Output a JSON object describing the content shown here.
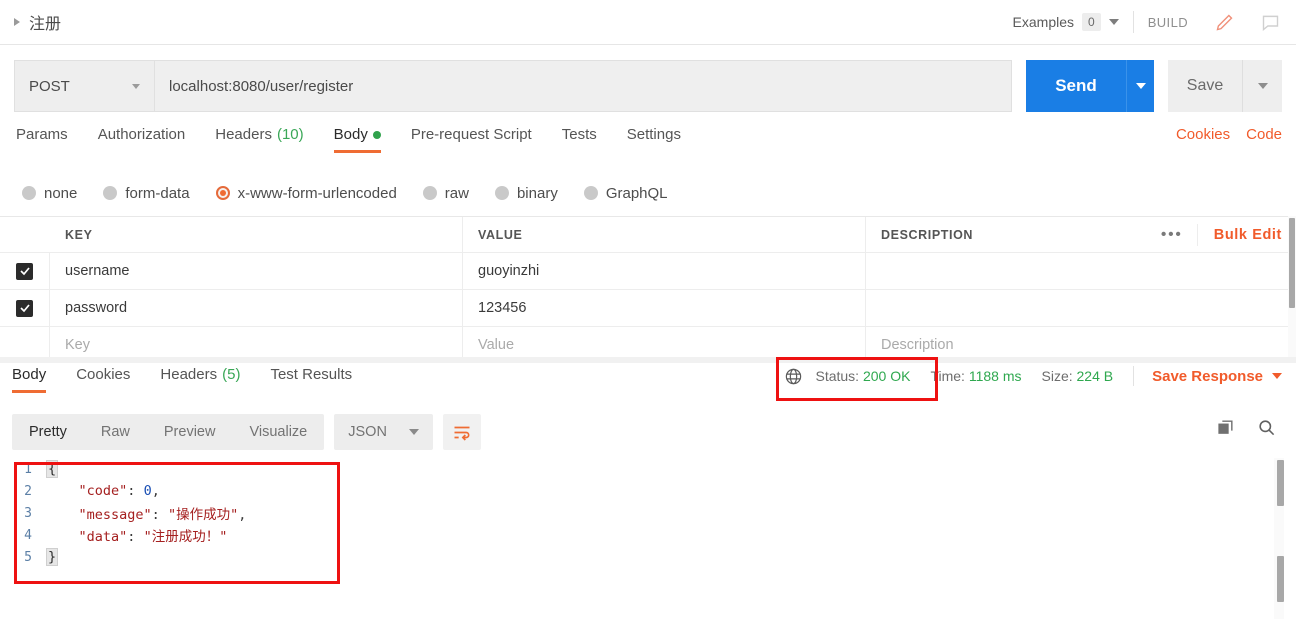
{
  "window": {
    "request_name": "注册",
    "collapse_icon": "triangle-right-icon"
  },
  "header": {
    "examples_label": "Examples",
    "examples_count": "0",
    "build_label": "BUILD",
    "edit_icon": "pencil-icon",
    "comment_icon": "comment-icon"
  },
  "url_bar": {
    "method": "POST",
    "url": "localhost:8080/user/register",
    "send_label": "Send",
    "save_label": "Save"
  },
  "request_tabs": [
    {
      "label": "Params",
      "count": "",
      "active": false
    },
    {
      "label": "Authorization",
      "count": "",
      "active": false
    },
    {
      "label": "Headers",
      "count": "(10)",
      "active": false
    },
    {
      "label": "Body",
      "count": "",
      "active": true
    },
    {
      "label": "Pre-request Script",
      "count": "",
      "active": false
    },
    {
      "label": "Tests",
      "count": "",
      "active": false
    },
    {
      "label": "Settings",
      "count": "",
      "active": false
    }
  ],
  "request_tabs_right": {
    "cookies": "Cookies",
    "code": "Code"
  },
  "body_types": [
    {
      "label": "none",
      "selected": false
    },
    {
      "label": "form-data",
      "selected": false
    },
    {
      "label": "x-www-form-urlencoded",
      "selected": true
    },
    {
      "label": "raw",
      "selected": false
    },
    {
      "label": "binary",
      "selected": false
    },
    {
      "label": "GraphQL",
      "selected": false
    }
  ],
  "params_table": {
    "headers": {
      "key": "KEY",
      "value": "VALUE",
      "description": "DESCRIPTION"
    },
    "bulk_edit_label": "Bulk Edit",
    "more_icon": "ellipsis-icon",
    "rows": [
      {
        "checked": true,
        "key": "username",
        "value": "guoyinzhi",
        "description": ""
      },
      {
        "checked": true,
        "key": "password",
        "value": "123456",
        "description": ""
      }
    ],
    "placeholder_row": {
      "key": "Key",
      "value": "Value",
      "description": "Description"
    }
  },
  "response_tabs": [
    {
      "label": "Body",
      "count": "",
      "active": true
    },
    {
      "label": "Cookies",
      "count": "",
      "active": false
    },
    {
      "label": "Headers",
      "count": "(5)",
      "active": false
    },
    {
      "label": "Test Results",
      "count": "",
      "active": false
    }
  ],
  "response_meta": {
    "globe_icon": "globe-icon",
    "status_label": "Status:",
    "status_value": "200 OK",
    "time_label": "Time:",
    "time_value": "1188 ms",
    "size_label": "Size:",
    "size_value": "224 B",
    "save_response_label": "Save Response"
  },
  "response_toolbar": {
    "views": [
      {
        "label": "Pretty",
        "active": true
      },
      {
        "label": "Raw",
        "active": false
      },
      {
        "label": "Preview",
        "active": false
      },
      {
        "label": "Visualize",
        "active": false
      }
    ],
    "format": "JSON",
    "wrap_icon": "wrap-text-icon",
    "copy_icon": "copy-icon",
    "search_icon": "search-icon"
  },
  "response_body": {
    "language": "json",
    "lines": [
      {
        "n": "1",
        "segments": [
          {
            "t": "{",
            "c": "brace"
          }
        ]
      },
      {
        "n": "2",
        "segments": [
          {
            "t": "    ",
            "c": "punc"
          },
          {
            "t": "\"code\"",
            "c": "key"
          },
          {
            "t": ": ",
            "c": "punc"
          },
          {
            "t": "0",
            "c": "num"
          },
          {
            "t": ",",
            "c": "punc"
          }
        ]
      },
      {
        "n": "3",
        "segments": [
          {
            "t": "    ",
            "c": "punc"
          },
          {
            "t": "\"message\"",
            "c": "key"
          },
          {
            "t": ": ",
            "c": "punc"
          },
          {
            "t": "\"操作成功\"",
            "c": "str"
          },
          {
            "t": ",",
            "c": "punc"
          }
        ]
      },
      {
        "n": "4",
        "segments": [
          {
            "t": "    ",
            "c": "punc"
          },
          {
            "t": "\"data\"",
            "c": "key"
          },
          {
            "t": ": ",
            "c": "punc"
          },
          {
            "t": "\"注册成功！\"",
            "c": "str"
          }
        ]
      },
      {
        "n": "5",
        "segments": [
          {
            "t": "}",
            "c": "brace"
          }
        ]
      }
    ],
    "raw_text": "{\n    \"code\": 0,\n    \"message\": \"操作成功\",\n    \"data\": \"注册成功！\"\n}"
  },
  "annotations": [
    {
      "name": "status-highlight",
      "color": "#ee1111"
    },
    {
      "name": "response-body-highlight",
      "color": "#ee1111"
    }
  ],
  "colors": {
    "accent_orange": "#f15b2b",
    "send_blue": "#1a7ee5",
    "status_green": "#2fa84f",
    "annotation_red": "#ee1111"
  }
}
